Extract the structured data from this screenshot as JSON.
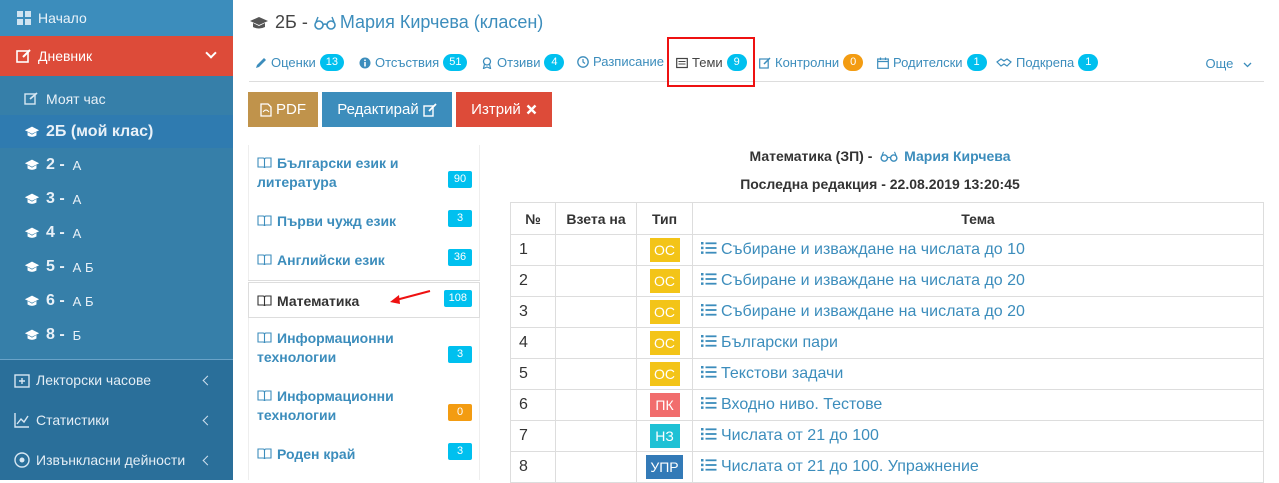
{
  "sidebar": {
    "home": "Начало",
    "diary": "Дневник",
    "my_hour": "Моят час",
    "classes": [
      {
        "num": "2Б (мой клас)",
        "sub": ""
      },
      {
        "num": "2 -",
        "sub": "А"
      },
      {
        "num": "3 -",
        "sub": "А"
      },
      {
        "num": "4 -",
        "sub": "А"
      },
      {
        "num": "5 -",
        "sub": "А Б"
      },
      {
        "num": "6 -",
        "sub": "А Б"
      },
      {
        "num": "8 -",
        "sub": "Б"
      }
    ],
    "lector": "Лекторски часове",
    "stats": "Статистики",
    "extra": "Извънкласни дейности"
  },
  "header": {
    "class_prefix": "2Б -",
    "teacher": "Мария Кирчева (класен)"
  },
  "tabs": [
    {
      "label": "Оценки",
      "badge": "13",
      "color": "blue"
    },
    {
      "label": "Отсъствия",
      "badge": "51",
      "color": "blue"
    },
    {
      "label": "Отзиви",
      "badge": "4",
      "color": "blue"
    },
    {
      "label": "Разписание",
      "badge": "",
      "color": "blue"
    },
    {
      "label": "Теми",
      "badge": "9",
      "color": "blue"
    },
    {
      "label": "Контролни",
      "badge": "0",
      "color": "yellow"
    },
    {
      "label": "Родителски",
      "badge": "1",
      "color": "blue"
    },
    {
      "label": "Подкрепа",
      "badge": "1",
      "color": "blue"
    }
  ],
  "tabs_more": "Още",
  "actions": {
    "pdf": "PDF",
    "edit": "Редактирай",
    "delete": "Изтрий"
  },
  "subjects": [
    {
      "name": "Български език и литература",
      "count": "90",
      "color": "blue"
    },
    {
      "name": "Първи чужд език",
      "count": "3",
      "color": "blue"
    },
    {
      "name": "Английски език",
      "count": "36",
      "color": "blue"
    },
    {
      "name": "Математика",
      "count": "108",
      "color": "blue"
    },
    {
      "name": "Информационни технологии",
      "count": "3",
      "color": "blue"
    },
    {
      "name": "Информационни технологии",
      "count": "0",
      "color": "yellow"
    },
    {
      "name": "Роден край",
      "count": "3",
      "color": "blue"
    }
  ],
  "content": {
    "subject_title": "Математика (ЗП) -",
    "teacher": "Мария Кирчева",
    "last_edit": "Последна редакция - 22.08.2019 13:20:45",
    "columns": [
      "№",
      "Взета на",
      "Тип",
      "Тема"
    ],
    "rows": [
      {
        "n": "1",
        "taken": "",
        "type": "ОС",
        "topic": "Събиране и изваждане на числата до 10"
      },
      {
        "n": "2",
        "taken": "",
        "type": "ОС",
        "topic": "Събиране и изваждане на числата до 20"
      },
      {
        "n": "3",
        "taken": "",
        "type": "ОС",
        "topic": "Събиране и изваждане на числата до 20"
      },
      {
        "n": "4",
        "taken": "",
        "type": "ОС",
        "topic": "Български пари"
      },
      {
        "n": "5",
        "taken": "",
        "type": "ОС",
        "topic": "Текстови задачи"
      },
      {
        "n": "6",
        "taken": "",
        "type": "ПК",
        "topic": "Входно ниво. Тестове"
      },
      {
        "n": "7",
        "taken": "",
        "type": "НЗ",
        "topic": "Числата от 21 до 100"
      },
      {
        "n": "8",
        "taken": "",
        "type": "УПР",
        "topic": "Числата от 21 до 100. Упражнение"
      }
    ]
  }
}
